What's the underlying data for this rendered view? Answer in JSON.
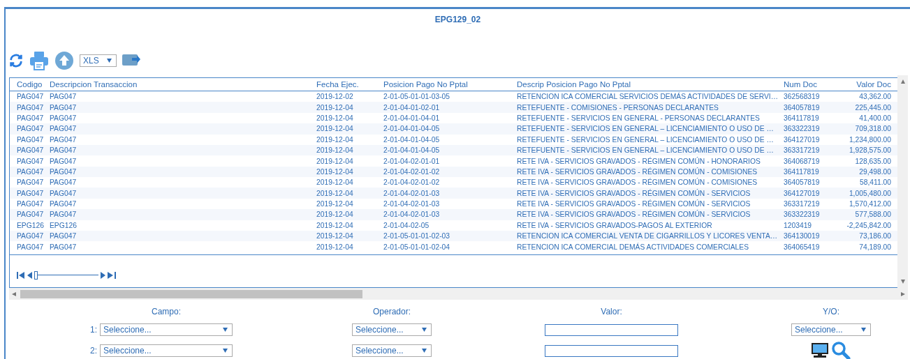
{
  "window": {
    "title": "EPG129_02"
  },
  "toolbar": {
    "format": "XLS"
  },
  "table": {
    "columns": [
      "Codigo",
      "Descripcion Transaccion",
      "Fecha Ejec.",
      "Posicion Pago No Pptal",
      "Descrip Posicion Pago No Pptal",
      "Num Doc",
      "Valor Doc"
    ],
    "rows": [
      [
        "PAG047",
        "PAG047",
        "2019-12-02",
        "2-01-05-01-01-03-05",
        "RETENCION ICA COMERCIAL SERVICIOS DEMÁS ACTIVIDADES DE SERVI…",
        "362568319",
        "43,362.00"
      ],
      [
        "PAG047",
        "PAG047",
        "2019-12-04",
        "2-01-04-01-02-01",
        "RETEFUENTE - COMISIONES - PERSONAS DECLARANTES",
        "364057819",
        "225,445.00"
      ],
      [
        "PAG047",
        "PAG047",
        "2019-12-04",
        "2-01-04-01-04-01",
        "RETEFUENTE - SERVICIOS EN GENERAL - PERSONAS DECLARANTES",
        "364117819",
        "41,400.00"
      ],
      [
        "PAG047",
        "PAG047",
        "2019-12-04",
        "2-01-04-01-04-05",
        "RETEFUENTE - SERVICIOS EN GENERAL – LICENCIAMIENTO O USO DE …",
        "363322319",
        "709,318.00"
      ],
      [
        "PAG047",
        "PAG047",
        "2019-12-04",
        "2-01-04-01-04-05",
        "RETEFUENTE - SERVICIOS EN GENERAL – LICENCIAMIENTO O USO DE …",
        "364127019",
        "1,234,800.00"
      ],
      [
        "PAG047",
        "PAG047",
        "2019-12-04",
        "2-01-04-01-04-05",
        "RETEFUENTE - SERVICIOS EN GENERAL – LICENCIAMIENTO O USO DE …",
        "363317219",
        "1,928,575.00"
      ],
      [
        "PAG047",
        "PAG047",
        "2019-12-04",
        "2-01-04-02-01-01",
        "RETE IVA - SERVICIOS GRAVADOS - RÉGIMEN COMÚN - HONORARIOS",
        "364068719",
        "128,635.00"
      ],
      [
        "PAG047",
        "PAG047",
        "2019-12-04",
        "2-01-04-02-01-02",
        "RETE IVA - SERVICIOS GRAVADOS - RÉGIMEN COMÚN - COMISIONES",
        "364117819",
        "29,498.00"
      ],
      [
        "PAG047",
        "PAG047",
        "2019-12-04",
        "2-01-04-02-01-02",
        "RETE IVA - SERVICIOS GRAVADOS - RÉGIMEN COMÚN - COMISIONES",
        "364057819",
        "58,411.00"
      ],
      [
        "PAG047",
        "PAG047",
        "2019-12-04",
        "2-01-04-02-01-03",
        "RETE IVA - SERVICIOS GRAVADOS - RÉGIMEN COMÚN - SERVICIOS",
        "364127019",
        "1,005,480.00"
      ],
      [
        "PAG047",
        "PAG047",
        "2019-12-04",
        "2-01-04-02-01-03",
        "RETE IVA - SERVICIOS GRAVADOS - RÉGIMEN COMÚN - SERVICIOS",
        "363317219",
        "1,570,412.00"
      ],
      [
        "PAG047",
        "PAG047",
        "2019-12-04",
        "2-01-04-02-01-03",
        "RETE IVA - SERVICIOS GRAVADOS - RÉGIMEN COMÚN - SERVICIOS",
        "363322319",
        "577,588.00"
      ],
      [
        "EPG126",
        "EPG126",
        "2019-12-04",
        "2-01-04-02-05",
        "RETE IVA - SERVICIOS GRAVADOS-PAGOS AL EXTERIOR",
        "1203419",
        "-2,245,842.00"
      ],
      [
        "PAG047",
        "PAG047",
        "2019-12-04",
        "2-01-05-01-01-02-03",
        "RETENCION ICA COMERCIAL VENTA DE CIGARRILLOS Y LICORES VENTA…",
        "364130019",
        "73,186.00"
      ],
      [
        "PAG047",
        "PAG047",
        "2019-12-04",
        "2-01-05-01-01-02-04",
        "RETENCION ICA COMERCIAL DEMÁS ACTIVIDADES COMERCIALES",
        "364065419",
        "74,189.00"
      ]
    ]
  },
  "pager": {
    "level": 0
  },
  "filter": {
    "headers": [
      "Campo:",
      "Operador:",
      "Valor:",
      "Y/O:"
    ],
    "rows": [
      {
        "number": "1:",
        "campo": "Seleccione...",
        "operador": "Seleccione...",
        "yo": "Seleccione..."
      },
      {
        "number": "2:",
        "campo": "Seleccione...",
        "operador": "Seleccione..."
      }
    ]
  }
}
